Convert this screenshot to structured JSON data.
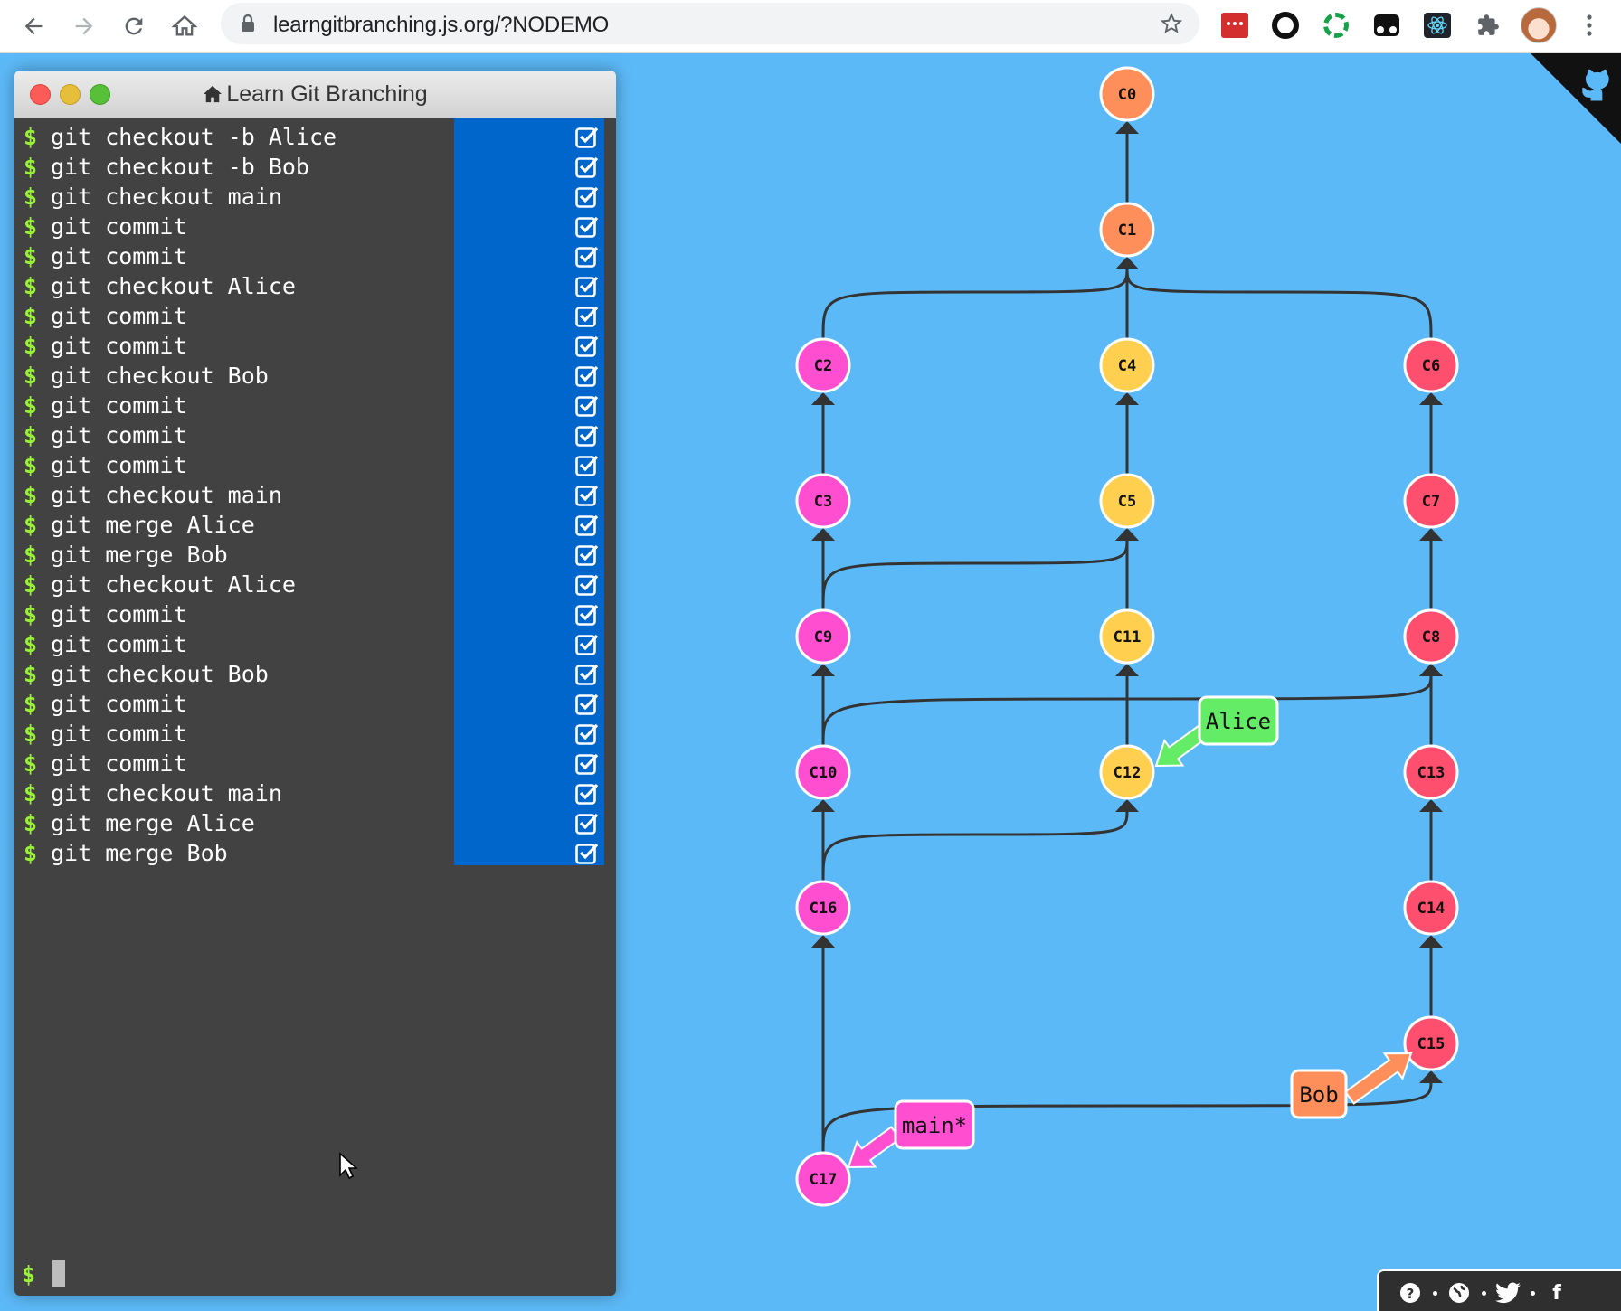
{
  "browser": {
    "url": "learngitbranching.js.org/?NODEMO"
  },
  "terminal": {
    "title": "Learn Git Branching",
    "prompt": "$",
    "commands": [
      "git checkout -b Alice",
      "git checkout -b Bob",
      "git checkout main",
      "git commit",
      "git commit",
      "git checkout Alice",
      "git commit",
      "git commit",
      "git checkout Bob",
      "git commit",
      "git commit",
      "git commit",
      "git checkout main",
      "git merge Alice",
      "git merge Bob",
      "git checkout Alice",
      "git commit",
      "git commit",
      "git checkout Bob",
      "git commit",
      "git commit",
      "git commit",
      "git checkout main",
      "git merge Alice",
      "git merge Bob"
    ]
  },
  "graph": {
    "colors": {
      "orange": "#ff8f5a",
      "pink": "#ff4fd0",
      "yellow": "#ffd04f",
      "red": "#ff4f6e",
      "edge": "#333333"
    },
    "commits": [
      {
        "id": "C0",
        "color": "orange"
      },
      {
        "id": "C1",
        "color": "orange"
      },
      {
        "id": "C2",
        "color": "pink"
      },
      {
        "id": "C3",
        "color": "pink"
      },
      {
        "id": "C4",
        "color": "yellow"
      },
      {
        "id": "C5",
        "color": "yellow"
      },
      {
        "id": "C6",
        "color": "red"
      },
      {
        "id": "C7",
        "color": "red"
      },
      {
        "id": "C8",
        "color": "red"
      },
      {
        "id": "C9",
        "color": "pink"
      },
      {
        "id": "C10",
        "color": "pink"
      },
      {
        "id": "C11",
        "color": "yellow"
      },
      {
        "id": "C12",
        "color": "yellow"
      },
      {
        "id": "C13",
        "color": "red"
      },
      {
        "id": "C14",
        "color": "red"
      },
      {
        "id": "C15",
        "color": "red"
      },
      {
        "id": "C16",
        "color": "pink"
      },
      {
        "id": "C17",
        "color": "pink"
      }
    ],
    "branches": [
      {
        "name": "Alice",
        "color": "#65ec66",
        "target": "C12"
      },
      {
        "name": "Bob",
        "color": "#ff8f5a",
        "target": "C15"
      },
      {
        "name": "main*",
        "color": "#ff4fd0",
        "target": "C17"
      }
    ]
  },
  "footer": {
    "icons": [
      "help-icon",
      "globe-icon",
      "twitter-icon",
      "facebook-icon"
    ]
  }
}
